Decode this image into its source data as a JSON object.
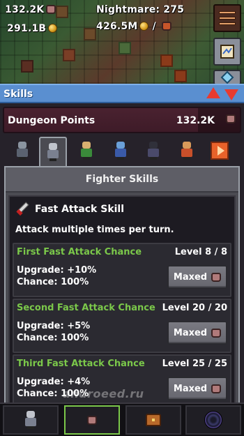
{
  "hud": {
    "dungeon_points": "132.2K",
    "gold": "291.1B",
    "nightmare": "Nightmare: 275",
    "resource": "426.5M",
    "resource_suffix": "/"
  },
  "skills_panel": {
    "title": "Skills",
    "dungeon_points_label": "Dungeon Points",
    "dungeon_points_value": "132.2K",
    "tabs": [
      "knight",
      "fighter",
      "ranger",
      "mage",
      "ninja",
      "monk",
      "next"
    ],
    "active_tab": "fighter",
    "window_title": "Fighter Skills",
    "skill": {
      "name": "Fast Attack Skill",
      "description": "Attack multiple times per turn.",
      "upgrades": [
        {
          "name": "First Fast Attack Chance",
          "level": "Level 8 / 8",
          "line1": "Upgrade: +10%",
          "line2": "Chance: 100%",
          "button": "Maxed"
        },
        {
          "name": "Second Fast Attack Chance",
          "level": "Level 20 / 20",
          "line1": "Upgrade: +5%",
          "line2": "Chance: 100%",
          "button": "Maxed"
        },
        {
          "name": "Third Fast Attack Chance",
          "level": "Level 25 / 25",
          "line1": "Upgrade: +4%",
          "line2": "Chance: 100%",
          "button": "Maxed"
        }
      ]
    }
  },
  "bottom_nav": [
    "heroes",
    "skills",
    "items",
    "portal"
  ],
  "watermark": "androeed.ru",
  "colors": {
    "accent_header": "#5a8fd0",
    "upgrade_name": "#7bc84a",
    "arrows": "#e83b30"
  }
}
